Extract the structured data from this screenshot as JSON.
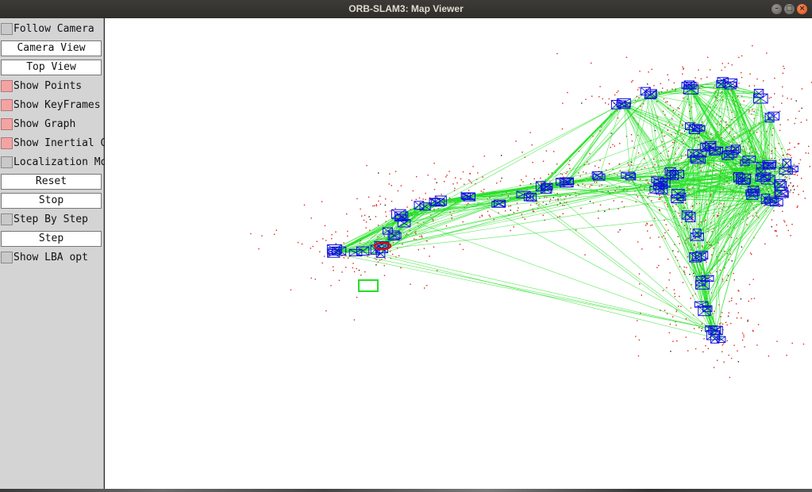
{
  "window": {
    "title": "ORB-SLAM3: Map Viewer",
    "buttons": [
      "minimize",
      "maximize",
      "close"
    ]
  },
  "panel": {
    "controls": [
      {
        "type": "checkbox",
        "label": "Follow Camera",
        "checked": false
      },
      {
        "type": "button",
        "label": "Camera View"
      },
      {
        "type": "button",
        "label": "Top View"
      },
      {
        "type": "checkbox",
        "label": "Show Points",
        "checked": true
      },
      {
        "type": "checkbox",
        "label": "Show KeyFrames",
        "checked": true
      },
      {
        "type": "checkbox",
        "label": "Show Graph",
        "checked": true
      },
      {
        "type": "checkbox",
        "label": "Show Inertial Graph",
        "checked": true
      },
      {
        "type": "checkbox",
        "label": "Localization Mode",
        "checked": false
      },
      {
        "type": "button",
        "label": "Reset"
      },
      {
        "type": "button",
        "label": "Stop"
      },
      {
        "type": "checkbox",
        "label": "Step By Step",
        "checked": false
      },
      {
        "type": "button",
        "label": "Step"
      },
      {
        "type": "checkbox",
        "label": "Show LBA opt",
        "checked": false
      }
    ]
  },
  "map": {
    "colors": {
      "map_points": "#e0201a",
      "reference_points": "#222222",
      "keyframes": "#1010e0",
      "covisibility_graph": "#22e022",
      "current_camera": "#d01010"
    }
  }
}
